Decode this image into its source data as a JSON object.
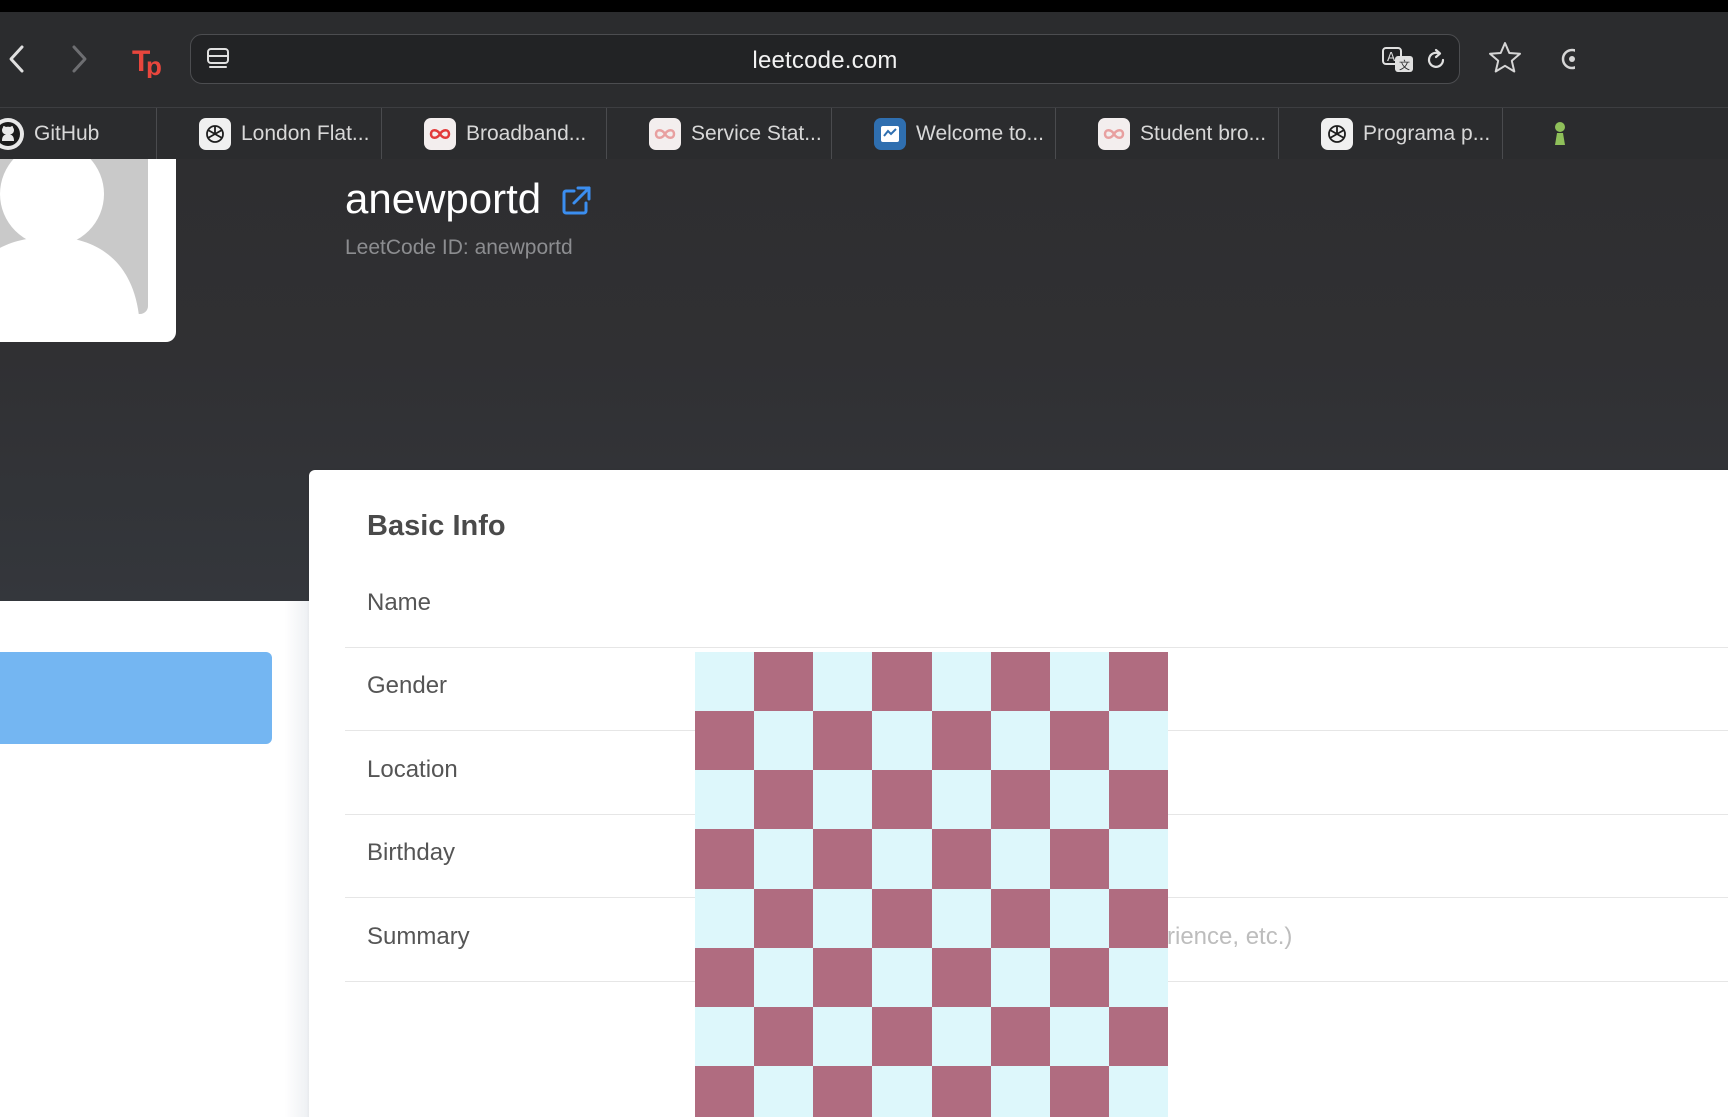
{
  "browser": {
    "url": "leetcode.com",
    "bookmarks": [
      {
        "label": "GitHub",
        "icon": "github-icon"
      },
      {
        "label": "London Flat...",
        "icon": "chatgpt-icon"
      },
      {
        "label": "Broadband...",
        "icon": "infinity-icon"
      },
      {
        "label": "Service Stat...",
        "icon": "infinity-icon"
      },
      {
        "label": "Welcome to...",
        "icon": "welcome-icon"
      },
      {
        "label": "Student bro...",
        "icon": "infinity-icon"
      },
      {
        "label": "Programa p...",
        "icon": "chatgpt-icon"
      }
    ]
  },
  "profile": {
    "username": "anewportd",
    "leetcode_id_label": "LeetCode ID: anewportd"
  },
  "basic_info": {
    "title": "Basic Info",
    "rows": [
      {
        "label": "Name"
      },
      {
        "label": "Gender"
      },
      {
        "label": "Location"
      },
      {
        "label": "Birthday"
      },
      {
        "label": "Summary",
        "placeholder": "rience, etc.)"
      }
    ]
  },
  "colors": {
    "checker_a": "#ddf7fb",
    "checker_b": "#b06c80",
    "accent_button": "#74b6f2",
    "link_icon": "#3b8ef0"
  }
}
